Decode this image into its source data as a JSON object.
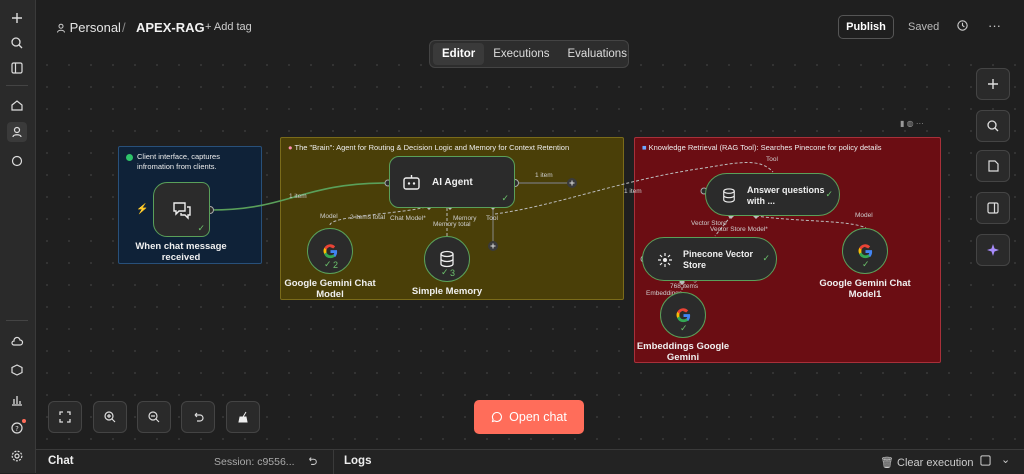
{
  "header": {
    "workspace": "Personal",
    "separator": "/",
    "workflow_name": "APEX-RAG",
    "add_tag": "+ Add tag",
    "publish": "Publish",
    "saved": "Saved"
  },
  "tabs": [
    {
      "label": "Editor",
      "active": true
    },
    {
      "label": "Executions",
      "active": false
    },
    {
      "label": "Evaluations",
      "active": false
    }
  ],
  "stickies": {
    "client": "Client interface, captures infromation from clients.",
    "brain": "The \"Brain\": Agent for Routing & Decision Logic and Memory for Context Retention",
    "rag": "Knowledge Retrieval (RAG Tool): Searches Pinecone for policy details"
  },
  "nodes": {
    "trigger": "When chat message received",
    "agent": "AI Agent",
    "gemini_chat": "Google Gemini Chat Model",
    "memory": "Simple Memory",
    "answer": "Answer questions with ...",
    "pinecone": "Pinecone Vector Store",
    "gemini_chat1": "Google Gemini Chat Model1",
    "embeddings": "Embeddings Google Gemini"
  },
  "edges": {
    "item_1a": "1 item",
    "item_1b": "1 item",
    "item_1c": "1 item",
    "items_2_total": "2 items total",
    "memory_total": "Memory total",
    "items_768": "768 items",
    "model": "Model",
    "chat_model": "Chat Model*",
    "memory": "Memory",
    "tool": "Tool",
    "tool_top": "Tool",
    "vector_store": "Vector Store",
    "vector_store_model": "Vector Store Model*",
    "model_right": "Model",
    "embeddings": "Embeddings"
  },
  "badges": {
    "gemini_count": "2",
    "memory_count": "3"
  },
  "open_chat": "Open chat",
  "bottom": {
    "chat": "Chat",
    "session": "Session: c9556...",
    "logs": "Logs",
    "clear": "Clear execution"
  },
  "colors": {
    "accent": "#ff6d5a",
    "node_success": "#5aa05a",
    "sticky_blue": "#0f2238",
    "sticky_yellow": "#4a3f08",
    "sticky_red": "#6b0d13"
  }
}
